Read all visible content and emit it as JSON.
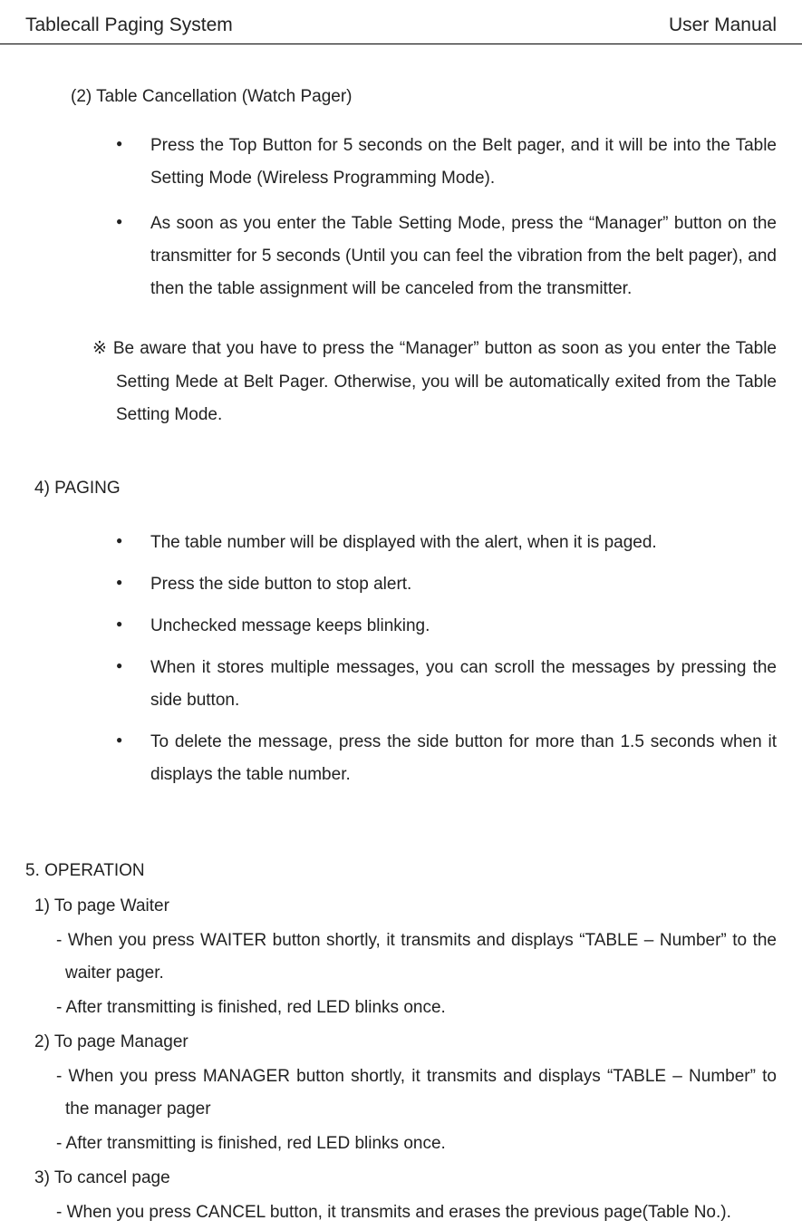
{
  "header": {
    "left": "Tablecall Paging System",
    "right": "User Manual"
  },
  "section2": {
    "title": "(2)  Table Cancellation (Watch Pager)",
    "bullets": [
      "Press the Top Button for 5 seconds on the Belt pager, and it will be into the Table Setting Mode (Wireless Programming Mode).",
      "As soon as you enter the Table Setting Mode, press the “Manager” button on the transmitter for 5 seconds (Until you can feel the vibration from the belt pager), and then the table assignment will be canceled from the transmitter."
    ],
    "note": "※ Be aware that you have to press the “Manager” button as soon as you enter the Table Setting Mede at Belt Pager. Otherwise, you will be automatically exited from the Table Setting Mode."
  },
  "section4": {
    "title": "4) PAGING",
    "bullets": [
      "The table number will be displayed with the alert, when it is paged.",
      "Press the side button to stop alert.",
      "Unchecked message keeps blinking.",
      "When it stores multiple messages, you can scroll the messages by pressing the side button.",
      "To delete the message, press the side button for more than 1.5 seconds when it displays the table number."
    ]
  },
  "operation": {
    "title": "5. OPERATION",
    "items": [
      {
        "sub": "1) To page Waiter",
        "lines": [
          "- When you press WAITER button shortly, it transmits and displays “TABLE – Number” to the waiter pager.",
          "- After transmitting is finished, red LED blinks once."
        ]
      },
      {
        "sub": "2) To page Manager",
        "lines": [
          "- When you press MANAGER button shortly, it transmits and displays “TABLE – Number” to the manager pager",
          "- After transmitting is finished, red LED blinks once."
        ]
      },
      {
        "sub": "3) To cancel page",
        "lines": [
          "- When you press CANCEL button, it transmits and erases the previous page(Table No.)."
        ]
      }
    ]
  }
}
